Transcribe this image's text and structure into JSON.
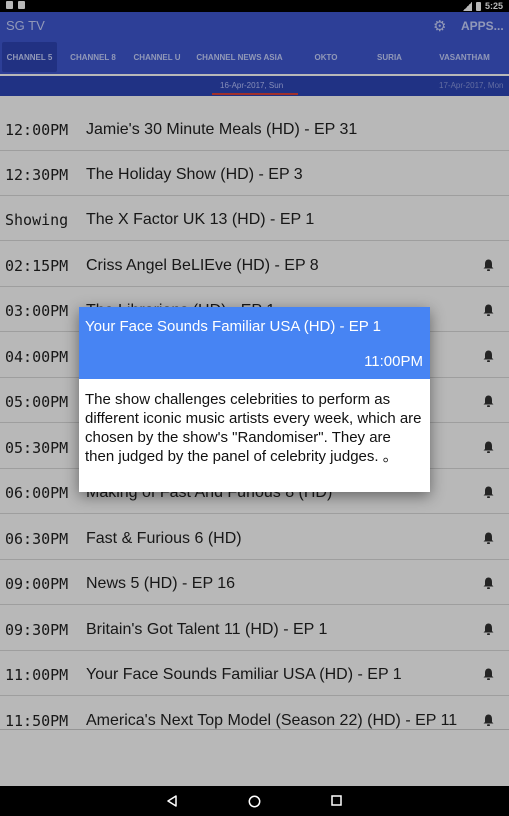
{
  "status_bar": {
    "time": "5:25"
  },
  "app_bar": {
    "title": "SG TV",
    "apps_label": "APPS...",
    "settings_icon": "gear-icon"
  },
  "tabs": [
    {
      "label": "CHANNEL 5",
      "active": true
    },
    {
      "label": "CHANNEL 8",
      "active": false
    },
    {
      "label": "CHANNEL U",
      "active": false
    },
    {
      "label": "CHANNEL NEWS ASIA",
      "active": false
    },
    {
      "label": "OKTO",
      "active": false
    },
    {
      "label": "SURIA",
      "active": false
    },
    {
      "label": "VASANTHAM",
      "active": false
    }
  ],
  "dates": {
    "current": "16-Apr-2017, Sun",
    "next": "17-Apr-2017, Mon"
  },
  "schedule": [
    {
      "time": "12:00PM",
      "program": "Jamie's 30 Minute Meals (HD) - EP 31",
      "reminder": false
    },
    {
      "time": "12:30PM",
      "program": "The Holiday Show (HD) - EP 3",
      "reminder": false
    },
    {
      "time": "Showing",
      "program": "The X Factor UK 13 (HD) - EP 1",
      "reminder": false
    },
    {
      "time": "02:15PM",
      "program": "Criss Angel BeLIEve (HD) - EP 8",
      "reminder": true
    },
    {
      "time": "03:00PM",
      "program": "The Librarians (HD) - EP 1",
      "reminder": true
    },
    {
      "time": "04:00PM",
      "program": "",
      "reminder": true
    },
    {
      "time": "05:00PM",
      "program": "",
      "reminder": true
    },
    {
      "time": "05:30PM",
      "program": "",
      "reminder": true
    },
    {
      "time": "06:00PM",
      "program": "Making of Fast And Furious 8 (HD)",
      "reminder": true
    },
    {
      "time": "06:30PM",
      "program": "Fast & Furious 6 (HD)",
      "reminder": true
    },
    {
      "time": "09:00PM",
      "program": "News 5 (HD) - EP 16",
      "reminder": true
    },
    {
      "time": "09:30PM",
      "program": "Britain's Got Talent 11 (HD) - EP 1",
      "reminder": true
    },
    {
      "time": "11:00PM",
      "program": "Your Face Sounds Familiar USA (HD) - EP 1",
      "reminder": true
    },
    {
      "time": "11:50PM",
      "program": "America's Next Top Model (Season 22) (HD) - EP 11",
      "reminder": true
    }
  ],
  "dialog": {
    "title": "Your Face Sounds Familiar USA (HD) - EP 1",
    "time": "11:00PM",
    "description": "The show challenges celebrities to perform as different iconic music artists every week, which are chosen by the show's \"Randomiser\". They are then judged by the panel of celebrity judges. 。"
  },
  "nav_bar": {
    "back_icon": "back-icon",
    "home_icon": "home-icon",
    "recents_icon": "recents-icon"
  }
}
